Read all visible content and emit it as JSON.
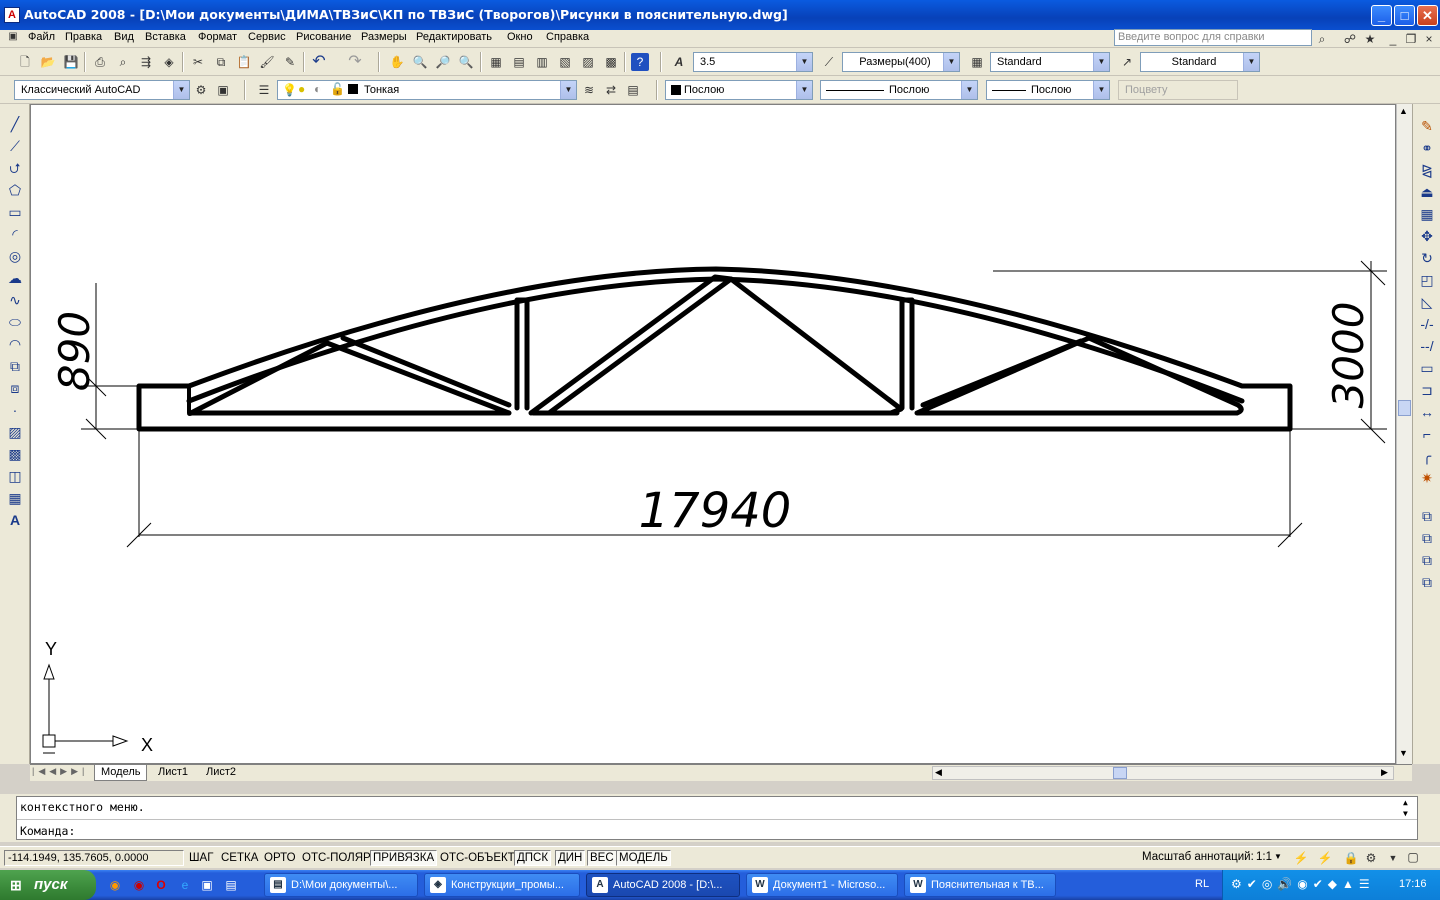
{
  "window": {
    "title": "AutoCAD 2008 - [D:\\Мои документы\\ДИМА\\ТВЗиС\\КП по ТВЗиС (Творогов)\\Рисунки в пояснительную.dwg]",
    "min_glyph": "_",
    "max_glyph": "□",
    "close_glyph": "✕"
  },
  "menu": {
    "items": [
      "Файл",
      "Правка",
      "Вид",
      "Вставка",
      "Формат",
      "Сервис",
      "Рисование",
      "Размеры",
      "Редактировать",
      "Окно",
      "Справка"
    ],
    "help_placeholder": "Введите вопрос для справки"
  },
  "toolbar1": {
    "text_height": "3.5",
    "dim_style": "Размеры(400)",
    "table_style": "Standard",
    "multileader_style": "Standard"
  },
  "toolbar2": {
    "workspace": "Классический AutoCAD",
    "layer": "Тонкая",
    "color": "Послою",
    "linetype": "Послою",
    "lineweight": "Послою",
    "plotstyle": "Поцвету"
  },
  "drawing": {
    "dim_left": "890",
    "dim_right": "3000",
    "dim_bottom": "17940",
    "ucs_y": "Y",
    "ucs_x": "X"
  },
  "tabs": [
    "Модель",
    "Лист1",
    "Лист2"
  ],
  "command": {
    "history": "контекстного меню.",
    "prompt": "Команда:"
  },
  "status": {
    "coords": "-114.1949, 135.7605, 0.0000",
    "buttons": [
      {
        "label": "ШАГ",
        "on": false
      },
      {
        "label": "СЕТКА",
        "on": false
      },
      {
        "label": "ОРТО",
        "on": false
      },
      {
        "label": "ОТС-ПОЛЯР",
        "on": false
      },
      {
        "label": "ПРИВЯЗКА",
        "on": true
      },
      {
        "label": "ОТС-ОБЪЕКТ",
        "on": false
      },
      {
        "label": "ДПСК",
        "on": true
      },
      {
        "label": "ДИН",
        "on": true
      },
      {
        "label": "ВЕС",
        "on": true
      },
      {
        "label": "МОДЕЛЬ",
        "on": true
      }
    ],
    "annotation_label": "Масштаб аннотаций:",
    "annotation_value": "1:1"
  },
  "taskbar": {
    "start": "пуск",
    "tasks": [
      {
        "label": "D:\\Мои документы\\...",
        "active": false
      },
      {
        "label": "Конструкции_промы...",
        "active": false
      },
      {
        "label": "AutoCAD 2008 - [D:\\...",
        "active": true
      },
      {
        "label": "Документ1 - Microso...",
        "active": false
      },
      {
        "label": "Пояснительная к ТВ...",
        "active": false
      }
    ],
    "lang": "RL",
    "clock": "17:16"
  }
}
